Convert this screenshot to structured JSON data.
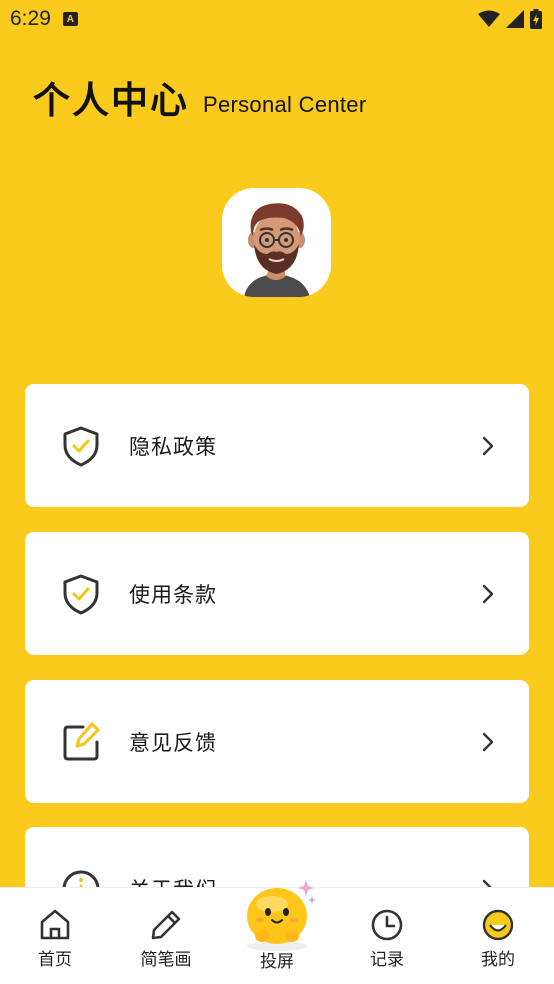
{
  "status_bar": {
    "time": "6:29",
    "notification_icon_text": "A"
  },
  "header": {
    "title_cn": "个人中心",
    "title_en": "Personal Center"
  },
  "menu": {
    "items": [
      {
        "label": "隐私政策",
        "icon": "shield-check-icon"
      },
      {
        "label": "使用条款",
        "icon": "shield-check-icon"
      },
      {
        "label": "意见反馈",
        "icon": "edit-icon"
      },
      {
        "label": "关于我们",
        "icon": "info-icon"
      }
    ]
  },
  "bottom_nav": {
    "items": [
      {
        "label": "首页",
        "icon": "home-icon"
      },
      {
        "label": "简笔画",
        "icon": "pencil-icon"
      },
      {
        "label": "投屏",
        "icon": "mascot-icon"
      },
      {
        "label": "记录",
        "icon": "clock-icon"
      },
      {
        "label": "我的",
        "icon": "smile-icon"
      }
    ]
  },
  "colors": {
    "background": "#FACB1C",
    "accent": "#F5C518",
    "card": "#FFFFFF",
    "text": "#1A1A1A"
  }
}
